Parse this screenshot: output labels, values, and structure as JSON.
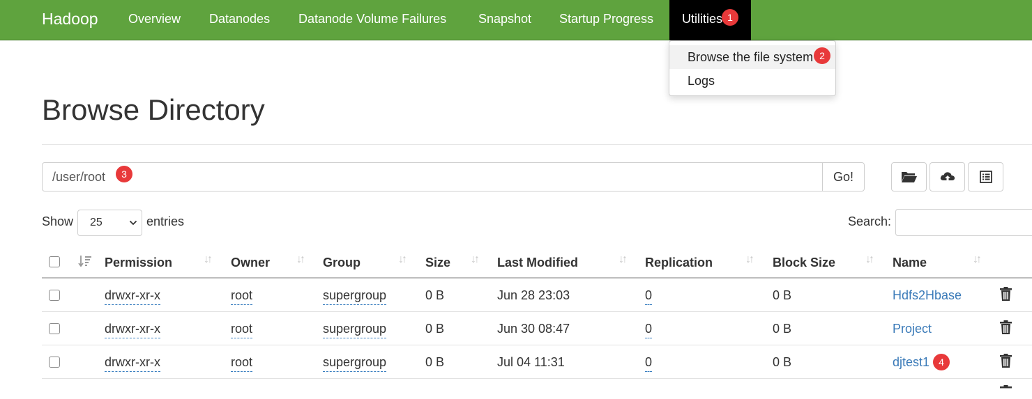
{
  "theme": {
    "nav_bg": "#5fa33e",
    "badge_color": "#e8393a",
    "link_color": "#3a7ab8"
  },
  "navbar": {
    "brand": "Hadoop",
    "items": [
      {
        "label": "Overview"
      },
      {
        "label": "Datanodes"
      },
      {
        "label": "Datanode Volume Failures"
      },
      {
        "label": "Snapshot"
      },
      {
        "label": "Startup Progress"
      },
      {
        "label": "Utilities",
        "active": true
      }
    ],
    "badge": "1"
  },
  "dropdown": {
    "items": [
      {
        "label": "Browse the file system",
        "hover": true
      },
      {
        "label": "Logs"
      }
    ],
    "badge": "2"
  },
  "page": {
    "title": "Browse Directory"
  },
  "path_bar": {
    "value": "/user/root",
    "badge": "3",
    "go_label": "Go!",
    "icons": [
      "folder-open-icon",
      "cloud-upload-icon",
      "list-icon"
    ]
  },
  "controls": {
    "show_label": "Show",
    "page_size": "25",
    "entries_label": "entries",
    "search_label": "Search:"
  },
  "table": {
    "headers": [
      "Permission",
      "Owner",
      "Group",
      "Size",
      "Last Modified",
      "Replication",
      "Block Size",
      "Name"
    ],
    "rows": [
      {
        "permission": "drwxr-xr-x",
        "owner": "root",
        "group": "supergroup",
        "size": "0 B",
        "modified": "Jun 28 23:03",
        "replication": "0",
        "block_size": "0 B",
        "name": "Hdfs2Hbase"
      },
      {
        "permission": "drwxr-xr-x",
        "owner": "root",
        "group": "supergroup",
        "size": "0 B",
        "modified": "Jun 30 08:47",
        "replication": "0",
        "block_size": "0 B",
        "name": "Project"
      },
      {
        "permission": "drwxr-xr-x",
        "owner": "root",
        "group": "supergroup",
        "size": "0 B",
        "modified": "Jul 04 11:31",
        "replication": "0",
        "block_size": "0 B",
        "name": "djtest1",
        "badge": "4"
      }
    ]
  }
}
